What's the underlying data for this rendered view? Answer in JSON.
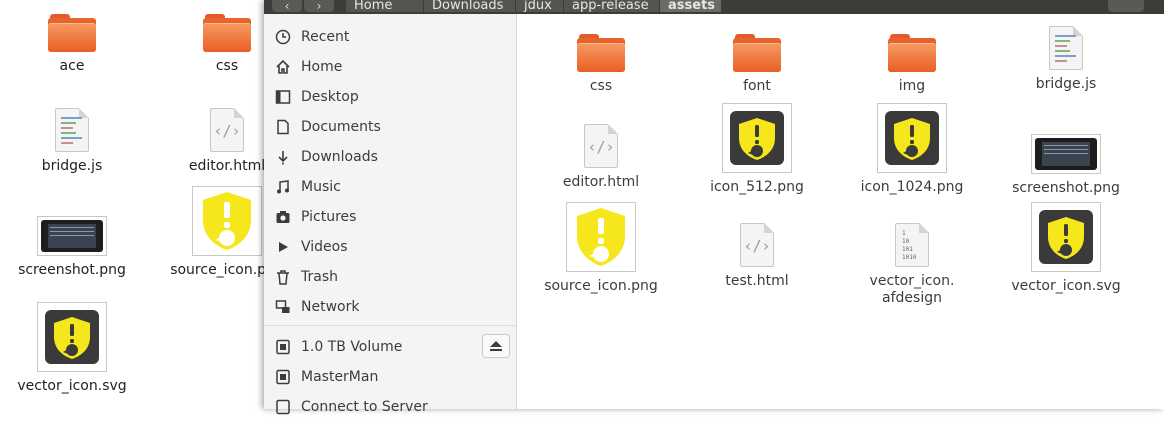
{
  "desktop": {
    "items": [
      {
        "label": "ace"
      },
      {
        "label": "css"
      },
      {
        "label": "bridge.js"
      },
      {
        "label": "editor.html"
      },
      {
        "label": "screenshot.png"
      },
      {
        "label": "source_icon.png"
      },
      {
        "label": "vector_icon.svg"
      }
    ]
  },
  "titlebar": {
    "back_icon": "‹",
    "forward_icon": "›",
    "breadcrumbs": [
      {
        "label": "Home"
      },
      {
        "label": "Downloads"
      },
      {
        "label": "jdux"
      },
      {
        "label": "app-release"
      },
      {
        "label": "assets"
      }
    ]
  },
  "sidebar": {
    "items": [
      {
        "label": "Recent",
        "icon": "clock-icon"
      },
      {
        "label": "Home",
        "icon": "home-icon"
      },
      {
        "label": "Desktop",
        "icon": "desktop-folder-icon"
      },
      {
        "label": "Documents",
        "icon": "document-icon"
      },
      {
        "label": "Downloads",
        "icon": "download-icon"
      },
      {
        "label": "Music",
        "icon": "music-icon"
      },
      {
        "label": "Pictures",
        "icon": "camera-icon"
      },
      {
        "label": "Videos",
        "icon": "video-icon"
      },
      {
        "label": "Trash",
        "icon": "trash-icon"
      },
      {
        "label": "Network",
        "icon": "network-icon"
      },
      {
        "label": "1.0 TB Volume",
        "icon": "drive-icon"
      },
      {
        "label": "MasterMan",
        "icon": "drive-icon"
      },
      {
        "label": "Connect to Server",
        "icon": "server-icon"
      }
    ]
  },
  "files": [
    {
      "label": "css",
      "type": "folder"
    },
    {
      "label": "font",
      "type": "folder"
    },
    {
      "label": "img",
      "type": "folder"
    },
    {
      "label": "bridge.js",
      "type": "script"
    },
    {
      "label": "editor.html",
      "type": "html"
    },
    {
      "label": "icon_512.png",
      "type": "image-shield-dark"
    },
    {
      "label": "icon_1024.png",
      "type": "image-shield-dark"
    },
    {
      "label": "screenshot.png",
      "type": "image-screenshot"
    },
    {
      "label": "source_icon.png",
      "type": "image-shield-yellow"
    },
    {
      "label": "test.html",
      "type": "html"
    },
    {
      "label": "vector_icon.\nafdesign",
      "type": "binary"
    },
    {
      "label": "vector_icon.svg",
      "type": "image-shield-dark"
    }
  ],
  "colors": {
    "folder_orange": "#e95f24",
    "shield_yellow": "#f6e71c",
    "dark_tile": "#3a3a3a",
    "titlebar": "#3d3c38"
  }
}
